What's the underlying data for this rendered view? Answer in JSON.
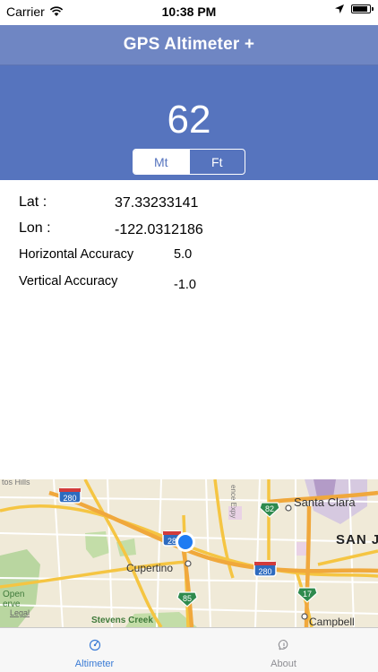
{
  "status_bar": {
    "carrier": "Carrier",
    "time": "10:38 PM",
    "icons": [
      "wifi-icon",
      "location-arrow-icon",
      "battery-icon"
    ]
  },
  "nav": {
    "title": "GPS Altimeter +"
  },
  "altitude": {
    "value": "62",
    "units": [
      {
        "label": "Mt",
        "selected": true
      },
      {
        "label": "Ft",
        "selected": false
      }
    ]
  },
  "location": {
    "lat_label": "Lat :",
    "lat_value": "37.33233141",
    "lon_label": "Lon :",
    "lon_value": "-122.0312186",
    "h_acc_label": "Horizontal Accuracy",
    "h_acc_value": "5.0",
    "v_acc_label": "Vertical Accuracy",
    "v_acc_value": "-1.0"
  },
  "map": {
    "labels": {
      "santa_clara": "Santa Clara",
      "san_jose": "SAN J",
      "cupertino": "Cupertino",
      "campbell": "Campbell",
      "stevens_creek": "Stevens Creek",
      "open_space": "Open",
      "open_space_2": "erve",
      "los_altos_hills": "tos Hills",
      "lawrence_expy": "ence Expy",
      "legal": "Legal"
    },
    "shields": {
      "i280_a": "280",
      "i280_b": "280",
      "i280_c": "28",
      "ca82": "82",
      "ca85": "85",
      "ca17": "17"
    }
  },
  "tabs": [
    {
      "label": "Altimeter",
      "icon": "altimeter-icon",
      "active": true
    },
    {
      "label": "About",
      "icon": "about-chat-icon",
      "active": false
    }
  ],
  "colors": {
    "nav_bar": "#6f86c3",
    "altitude_panel": "#5674be",
    "tab_active": "#3a7bd5",
    "map_base": "#f0ead8"
  }
}
